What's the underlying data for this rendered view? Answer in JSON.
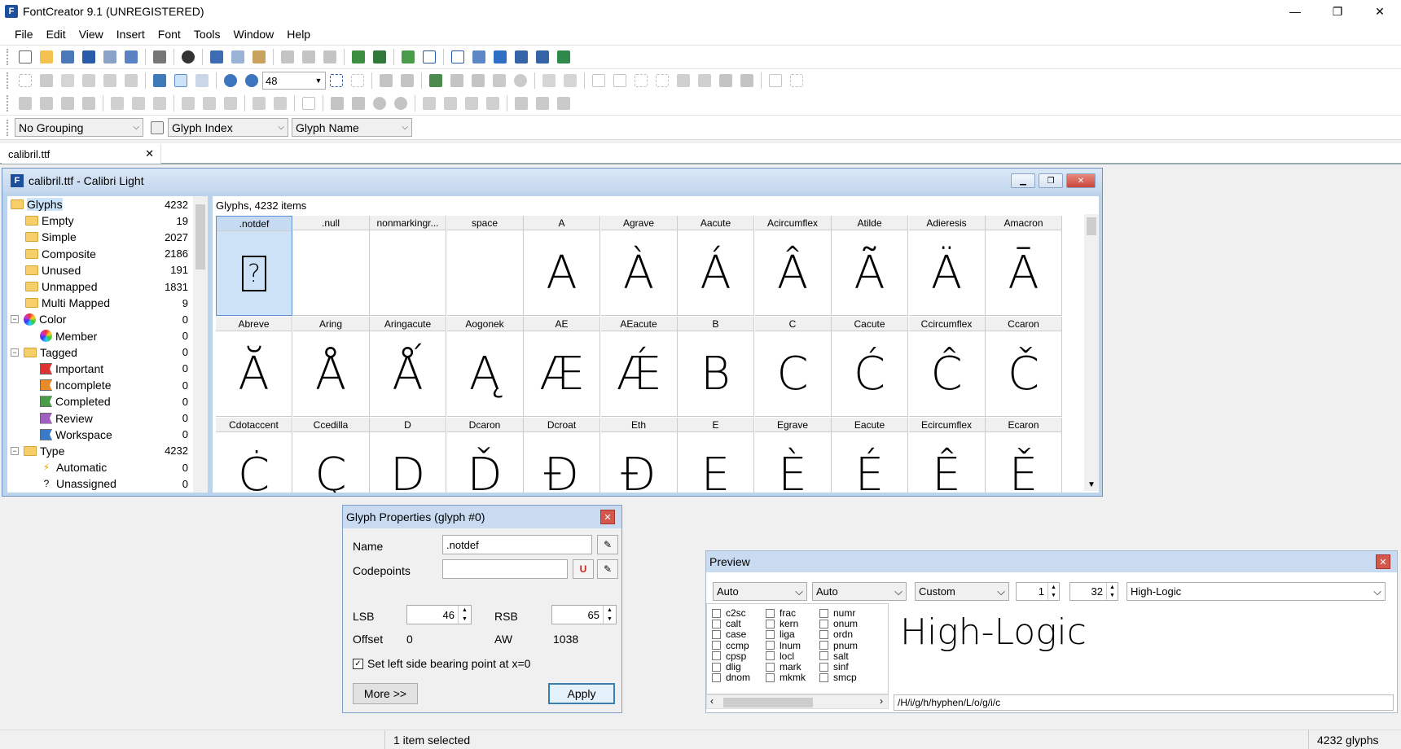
{
  "app": {
    "title": "FontCreator 9.1 (UNREGISTERED)",
    "icon_letter": "F"
  },
  "window_controls": {
    "minimize": "—",
    "maximize": "❐",
    "close": "✕"
  },
  "menu": [
    "File",
    "Edit",
    "View",
    "Insert",
    "Font",
    "Tools",
    "Window",
    "Help"
  ],
  "toolbar": {
    "zoom_value": "48"
  },
  "grouping": {
    "group_select": "No Grouping",
    "sort_select": "Glyph Index",
    "name_select": "Glyph Name"
  },
  "document_tab": {
    "label": "calibril.ttf",
    "close": "✕"
  },
  "font_window": {
    "title": "calibril.ttf - Calibri Light",
    "glyph_count_label": "Glyphs, 4232 items"
  },
  "tree": [
    {
      "label": "Glyphs",
      "count": "4232",
      "level": 0,
      "selected": true
    },
    {
      "label": "Empty",
      "count": "19",
      "level": 1
    },
    {
      "label": "Simple",
      "count": "2027",
      "level": 1
    },
    {
      "label": "Composite",
      "count": "2186",
      "level": 1
    },
    {
      "label": "Unused",
      "count": "191",
      "level": 1
    },
    {
      "label": "Unmapped",
      "count": "1831",
      "level": 1
    },
    {
      "label": "Multi Mapped",
      "count": "9",
      "level": 1
    },
    {
      "label": "Color",
      "count": "0",
      "level": 0,
      "expander": "−"
    },
    {
      "label": "Member",
      "count": "0",
      "level": 2
    },
    {
      "label": "Tagged",
      "count": "0",
      "level": 0,
      "expander": "−"
    },
    {
      "label": "Important",
      "count": "0",
      "level": 2
    },
    {
      "label": "Incomplete",
      "count": "0",
      "level": 2
    },
    {
      "label": "Completed",
      "count": "0",
      "level": 2
    },
    {
      "label": "Review",
      "count": "0",
      "level": 2
    },
    {
      "label": "Workspace",
      "count": "0",
      "level": 2
    },
    {
      "label": "Type",
      "count": "4232",
      "level": 0,
      "expander": "−"
    },
    {
      "label": "Automatic",
      "count": "0",
      "level": 2
    },
    {
      "label": "Unassigned",
      "count": "0",
      "level": 2
    }
  ],
  "glyphs": [
    [
      {
        "name": ".notdef",
        "char": "?"
      },
      {
        "name": ".null",
        "char": ""
      },
      {
        "name": "nonmarkingr...",
        "char": ""
      },
      {
        "name": "space",
        "char": ""
      },
      {
        "name": "A",
        "char": "A"
      },
      {
        "name": "Agrave",
        "char": "À"
      },
      {
        "name": "Aacute",
        "char": "Á"
      },
      {
        "name": "Acircumflex",
        "char": "Â"
      },
      {
        "name": "Atilde",
        "char": "Ã"
      },
      {
        "name": "Adieresis",
        "char": "Ä"
      },
      {
        "name": "Amacron",
        "char": "Ā"
      }
    ],
    [
      {
        "name": "Abreve",
        "char": "Ă"
      },
      {
        "name": "Aring",
        "char": "Å"
      },
      {
        "name": "Aringacute",
        "char": "Ǻ"
      },
      {
        "name": "Aogonek",
        "char": "Ą"
      },
      {
        "name": "AE",
        "char": "Æ"
      },
      {
        "name": "AEacute",
        "char": "Ǽ"
      },
      {
        "name": "B",
        "char": "B"
      },
      {
        "name": "C",
        "char": "C"
      },
      {
        "name": "Cacute",
        "char": "Ć"
      },
      {
        "name": "Ccircumflex",
        "char": "Ĉ"
      },
      {
        "name": "Ccaron",
        "char": "Č"
      }
    ],
    [
      {
        "name": "Cdotaccent",
        "char": "Ċ"
      },
      {
        "name": "Ccedilla",
        "char": "Ç"
      },
      {
        "name": "D",
        "char": "D"
      },
      {
        "name": "Dcaron",
        "char": "Ď"
      },
      {
        "name": "Dcroat",
        "char": "Đ"
      },
      {
        "name": "Eth",
        "char": "Ð"
      },
      {
        "name": "E",
        "char": "E"
      },
      {
        "name": "Egrave",
        "char": "È"
      },
      {
        "name": "Eacute",
        "char": "É"
      },
      {
        "name": "Ecircumflex",
        "char": "Ê"
      },
      {
        "name": "Ecaron",
        "char": "Ě"
      }
    ]
  ],
  "glyph_properties": {
    "title": "Glyph Properties (glyph #0)",
    "name_label": "Name",
    "name_value": ".notdef",
    "codepoints_label": "Codepoints",
    "codepoints_value": "",
    "lsb_label": "LSB",
    "lsb_value": "46",
    "rsb_label": "RSB",
    "rsb_value": "65",
    "offset_label": "Offset",
    "offset_value": "0",
    "aw_label": "AW",
    "aw_value": "1038",
    "checkbox_label": "Set left side bearing point at x=0",
    "checkbox_checked": true,
    "more_button": "More >>",
    "apply_button": "Apply"
  },
  "preview": {
    "title": "Preview",
    "combo1": "Auto",
    "combo2": "Auto",
    "combo3": "Custom",
    "spin1": "1",
    "spin2": "32",
    "text_combo": "High-Logic",
    "features": [
      [
        "c2sc",
        "frac",
        "numr"
      ],
      [
        "calt",
        "kern",
        "onum"
      ],
      [
        "case",
        "liga",
        "ordn"
      ],
      [
        "ccmp",
        "lnum",
        "pnum"
      ],
      [
        "cpsp",
        "locl",
        "salt"
      ],
      [
        "dlig",
        "mark",
        "sinf"
      ],
      [
        "dnom",
        "mkmk",
        "smcp"
      ]
    ],
    "sample_text": "High-Logic",
    "glyph_string": "/H/i/g/h/hyphen/L/o/g/i/c"
  },
  "status": {
    "selection": "1 item selected",
    "total": "4232 glyphs"
  }
}
